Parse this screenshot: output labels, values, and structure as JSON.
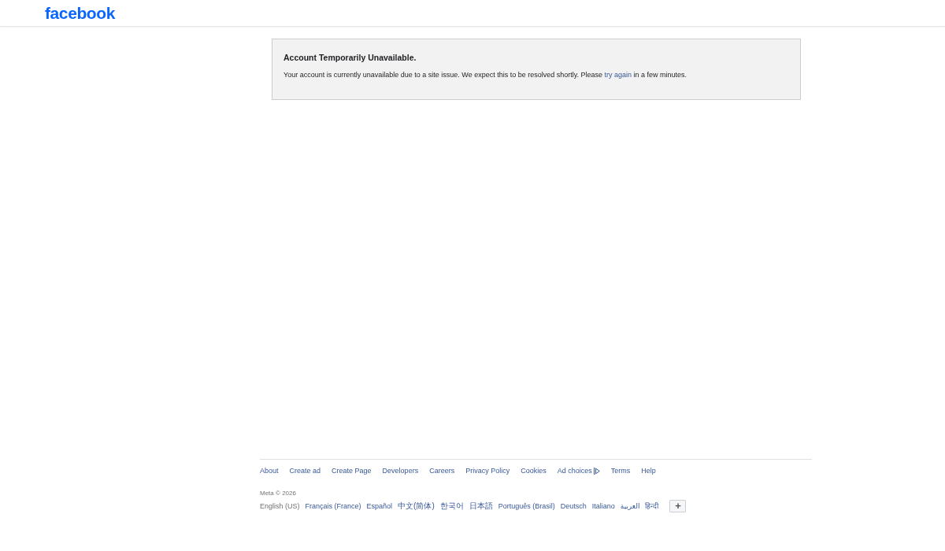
{
  "header": {
    "logo": "facebook"
  },
  "notice": {
    "title": "Account Temporarily Unavailable.",
    "message": [
      {
        "kind": "text",
        "text": "Your account is currently unavailable due to a site issue. We expect this to be resolved shortly. Please "
      },
      {
        "kind": "link",
        "text": "try again"
      },
      {
        "kind": "text",
        "text": " in a few minutes."
      }
    ]
  },
  "footer": {
    "links": [
      {
        "kind": "plain",
        "label": "About"
      },
      {
        "kind": "plain",
        "label": "Create ad"
      },
      {
        "kind": "plain",
        "label": "Create Page"
      },
      {
        "kind": "plain",
        "label": "Developers"
      },
      {
        "kind": "plain",
        "label": "Careers"
      },
      {
        "kind": "plain",
        "label": "Privacy Policy"
      },
      {
        "kind": "plain",
        "label": "Cookies"
      },
      {
        "kind": "with_icon",
        "label": "Ad choices"
      },
      {
        "kind": "plain",
        "label": "Terms"
      },
      {
        "kind": "plain",
        "label": "Help"
      }
    ],
    "copyright": "Meta © 2026",
    "languages": [
      {
        "label": "English (US)",
        "selected": true
      },
      {
        "label": "Français (France)",
        "selected": false
      },
      {
        "label": "Español",
        "selected": false
      },
      {
        "label": "中文(简体)",
        "selected": false
      },
      {
        "label": "한국어",
        "selected": false
      },
      {
        "label": "日本語",
        "selected": false
      },
      {
        "label": "Português (Brasil)",
        "selected": false
      },
      {
        "label": "Deutsch",
        "selected": false
      },
      {
        "label": "Italiano",
        "selected": false
      },
      {
        "label": "العربية",
        "selected": false
      },
      {
        "label": "हिन्दी",
        "selected": false
      }
    ],
    "more_languages_button": "+"
  }
}
